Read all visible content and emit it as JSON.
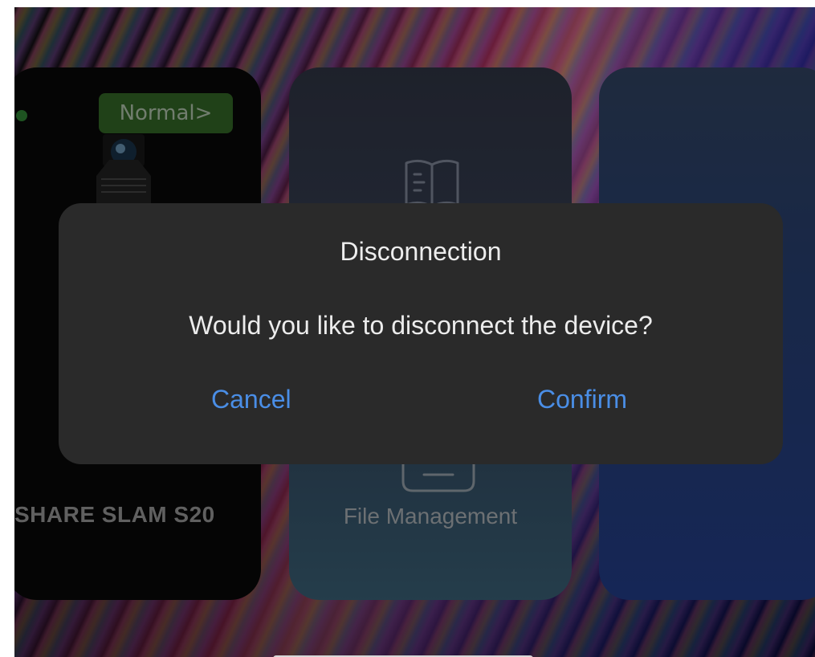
{
  "device_card": {
    "status_label": "Normal>",
    "device_name": "SHARE SLAM S20",
    "image_icon": "device-scanner-icon"
  },
  "file_card": {
    "top_icon": "manual-book-icon",
    "label": "File Management",
    "icon": "folder-icon"
  },
  "dialog": {
    "title": "Disconnection",
    "message": "Would you like to disconnect the device?",
    "cancel_label": "Cancel",
    "confirm_label": "Confirm"
  },
  "colors": {
    "accent": "#4a8ee6",
    "status_green": "#3e7d2f",
    "dialog_bg": "#2a2a2a"
  }
}
